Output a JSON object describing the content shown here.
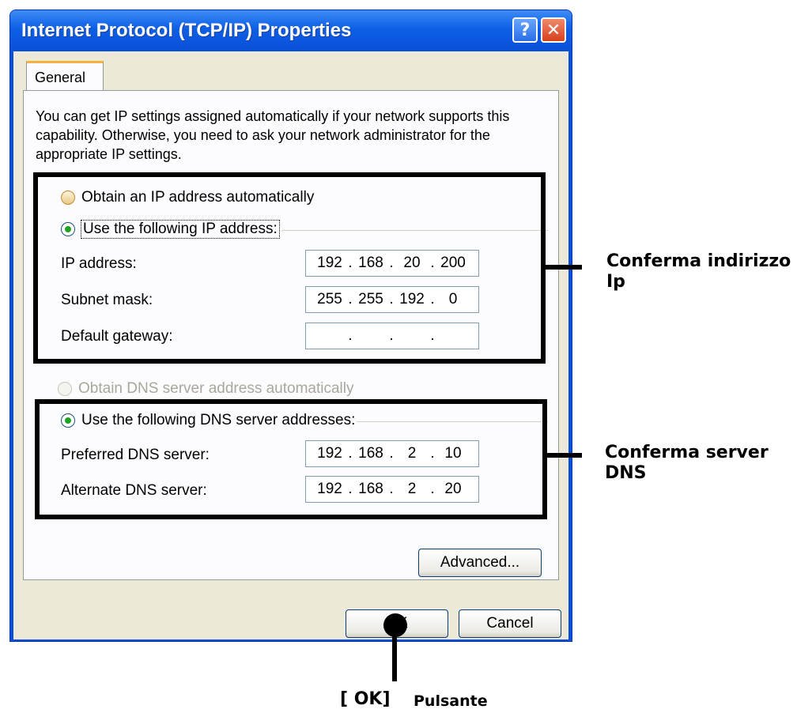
{
  "window": {
    "title": "Internet Protocol (TCP/IP) Properties",
    "help_symbol": "?",
    "close_symbol": "✕"
  },
  "tabs": [
    {
      "label": "General",
      "selected": true
    }
  ],
  "description": "You can get IP settings assigned automatically if your network supports this capability. Otherwise, you need to ask your network administrator for the appropriate IP settings.",
  "ip_section": {
    "auto_label": "Obtain an IP address automatically",
    "manual_label": "Use the following IP address:",
    "selected": "manual",
    "fields": [
      {
        "label": "IP address:",
        "octets": [
          "192",
          "168",
          "20",
          "200"
        ]
      },
      {
        "label": "Subnet mask:",
        "octets": [
          "255",
          "255",
          "192",
          "0"
        ]
      },
      {
        "label": "Default gateway:",
        "octets": [
          "",
          "",
          "",
          ""
        ]
      }
    ]
  },
  "dns_section": {
    "auto_label": "Obtain DNS server address automatically",
    "auto_enabled": false,
    "manual_label": "Use the following DNS server addresses:",
    "selected": "manual",
    "fields": [
      {
        "label": "Preferred DNS server:",
        "octets": [
          "192",
          "168",
          "2",
          "10"
        ]
      },
      {
        "label": "Alternate DNS server:",
        "octets": [
          "192",
          "168",
          "2",
          "20"
        ]
      }
    ]
  },
  "buttons": {
    "advanced": "Advanced...",
    "ok": "OK",
    "cancel": "Cancel"
  },
  "annotations": {
    "ip_confirm": "Conferma indirizzo Ip",
    "dns_confirm": "Conferma server DNS",
    "ok_key": "[ OK]",
    "ok_caption": "Pulsante"
  },
  "colors": {
    "titlebar": "#0a4fd8",
    "dialog_bg": "#ece9d8",
    "radio_selected": "#21a121",
    "annotation": "#000000"
  },
  "icons": [
    "help-icon",
    "close-icon",
    "radio-button"
  ]
}
